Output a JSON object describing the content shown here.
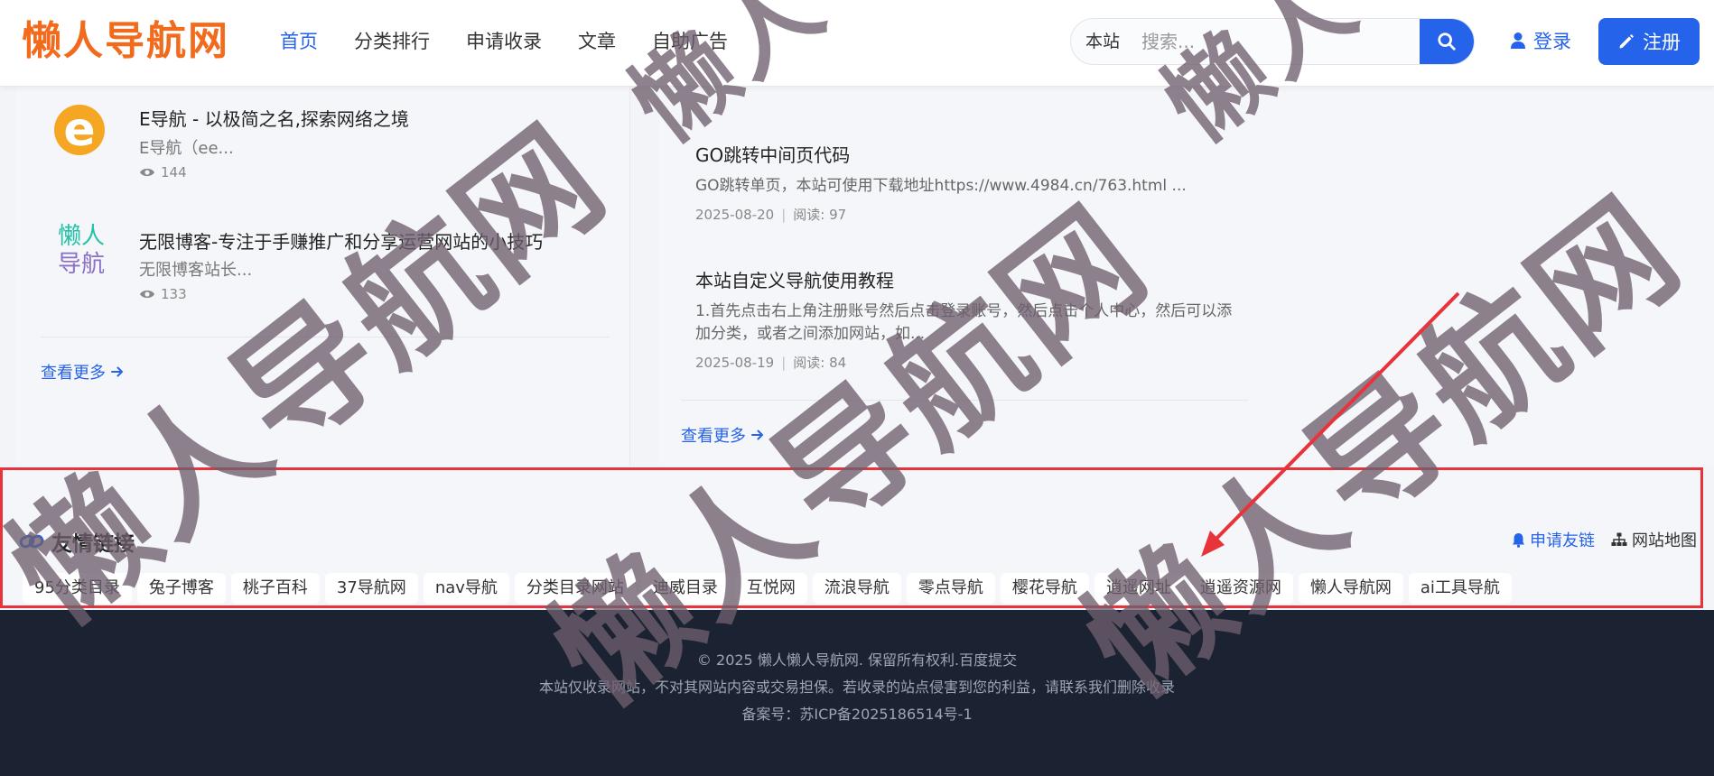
{
  "header": {
    "logo": "懒人导航网",
    "nav": [
      {
        "label": "首页",
        "active": true
      },
      {
        "label": "分类排行",
        "active": false
      },
      {
        "label": "申请收录",
        "active": false
      },
      {
        "label": "文章",
        "active": false
      },
      {
        "label": "自助广告",
        "active": false
      }
    ],
    "search": {
      "scope": "本站",
      "placeholder": "搜索...",
      "icon": "search-icon"
    },
    "login_label": "登录",
    "register_label": "注册"
  },
  "hot_sites": [
    {
      "logo_text": "e",
      "title": "E导航 - 以极简之名,探索网络之境",
      "desc": "E导航（ee...",
      "views": "144"
    },
    {
      "logo_text_1": "懒人",
      "logo_text_2": "导航",
      "title": "无限博客-专注于手赚推广和分享运营网站的小技巧",
      "desc": "无限博客站长...",
      "views": "133"
    }
  ],
  "articles": [
    {
      "title": "GO跳转中间页代码",
      "desc": "GO跳转单页，本站可使用下载地址https://www.4984.cn/763.html ...",
      "date": "2025-08-20",
      "reads": "阅读: 97"
    },
    {
      "title": "本站自定义导航使用教程",
      "desc": "1.首先点击右上角注册账号然后点击登录账号，然后点击个人中心，然后可以添加分类，或者之间添加网站，如...",
      "date": "2025-08-19",
      "reads": "阅读: 84"
    }
  ],
  "more_label": "查看更多",
  "friend_links": {
    "title": "友情链接",
    "apply_label": "申请友链",
    "sitemap_label": "网站地图",
    "links": [
      "95分类目录",
      "兔子博客",
      "桃子百科",
      "37导航网",
      "nav导航",
      "分类目录网站",
      "迪威目录",
      "互悦网",
      "流浪导航",
      "零点导航",
      "樱花导航",
      "逍遥网址",
      "逍遥资源网",
      "懒人导航网",
      "ai工具导航"
    ]
  },
  "footer": {
    "line1": "© 2025 懒人懒人导航网. 保留所有权利.百度提交",
    "line2": "本站仅收录网站，不对其网站内容或交易担保。若收录的站点侵害到您的利益，请联系我们删除收录",
    "line3": "备案号：苏ICP备2025186514号-1"
  },
  "watermark": "懒人导航网",
  "colors": {
    "accent": "#2563eb",
    "logo": "#f26b1d",
    "highlight_border": "#e8333a",
    "footer_bg": "#1b2231"
  }
}
